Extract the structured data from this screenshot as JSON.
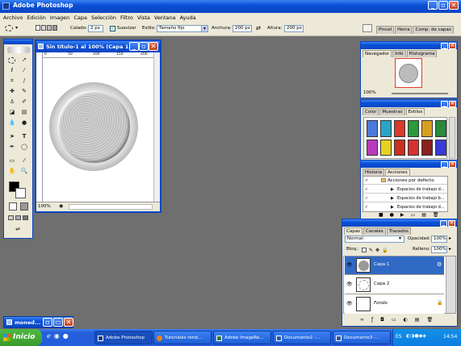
{
  "app_title": "Adobe Photoshop",
  "menu": [
    "Archivo",
    "Edición",
    "Imagen",
    "Capa",
    "Selección",
    "Filtro",
    "Vista",
    "Ventana",
    "Ayuda"
  ],
  "options": {
    "feather_label": "Calado:",
    "feather_value": "2 px",
    "antialias_label": "Suavizar",
    "style_label": "Estilo:",
    "style_value": "Tamaño fijo",
    "width_label": "Anchura:",
    "width_value": "200 px",
    "height_label": "Altura:",
    "height_value": "200 px",
    "palette_tabs": [
      "Pincel",
      "Herra",
      "Comp. de capas"
    ]
  },
  "document": {
    "title": "Sin título-1 al 100% (Capa 1...",
    "zoom": "100%",
    "ruler_ticks": [
      "0",
      "50",
      "100",
      "150",
      "200"
    ]
  },
  "navigator": {
    "tabs": [
      "Navegador",
      "Info",
      "Histograma"
    ],
    "zoom": "100%"
  },
  "color_panel": {
    "tabs": [
      "Color",
      "Muestras",
      "Estilos"
    ]
  },
  "history_panel": {
    "tabs": [
      "Historia",
      "Acciones"
    ],
    "set_name": "Acciones por defecto",
    "items": [
      "Espacios de trabajo d...",
      "Espacios de trabajo b...",
      "Espacios de trabajo d..."
    ]
  },
  "layers_panel": {
    "tabs": [
      "Capas",
      "Canales",
      "Trazados"
    ],
    "blend_mode": "Normal",
    "opacity_label": "Opacidad:",
    "opacity_value": "100%",
    "lock_label": "Bloq.:",
    "fill_label": "Relleno:",
    "fill_value": "100%",
    "layers": [
      {
        "name": "Capa 1"
      },
      {
        "name": "Capa 2"
      },
      {
        "name": "Fondo"
      }
    ]
  },
  "minimized_window": "moned...",
  "taskbar": {
    "start_label": "Inicio",
    "buttons": [
      "Adobe Photoshop",
      "Tutoriales rend...",
      "Adobe ImageRe...",
      "Documento2 -...",
      "Documento3 -...",
      "2 Microsof..."
    ],
    "lang": "ES",
    "clock": "14:54"
  },
  "colors": {
    "xp_blue": "#0a4fd6",
    "highlight": "#316ac5",
    "taskbar": "#245edb",
    "start_green": "#3a9a2c"
  }
}
